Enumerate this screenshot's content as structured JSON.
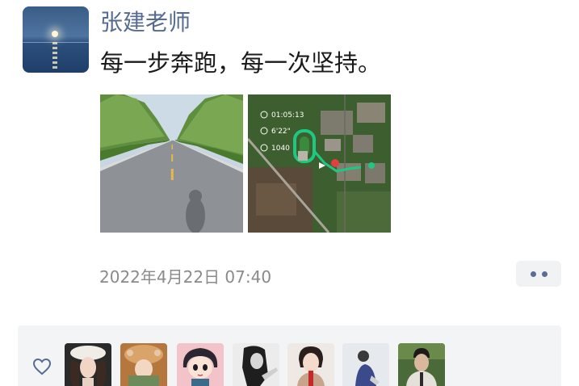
{
  "post": {
    "author": "张建老师",
    "text": "每一步奔跑，每一次坚持。",
    "timestamp": "2022年4月22日 07:40",
    "map_overlay": {
      "time": "01:05:13",
      "pace": "6'22\"",
      "calories": "1040"
    }
  },
  "likes": {
    "icon": "heart-icon",
    "avatars": [
      "liker-1",
      "liker-2",
      "liker-3",
      "liker-4",
      "liker-5",
      "liker-6",
      "liker-7"
    ]
  },
  "colors": {
    "author_name": "#566b94",
    "timestamp": "#8a8a8a",
    "panel_bg": "#f3f4f6",
    "more_dots": "#5a6d96"
  }
}
